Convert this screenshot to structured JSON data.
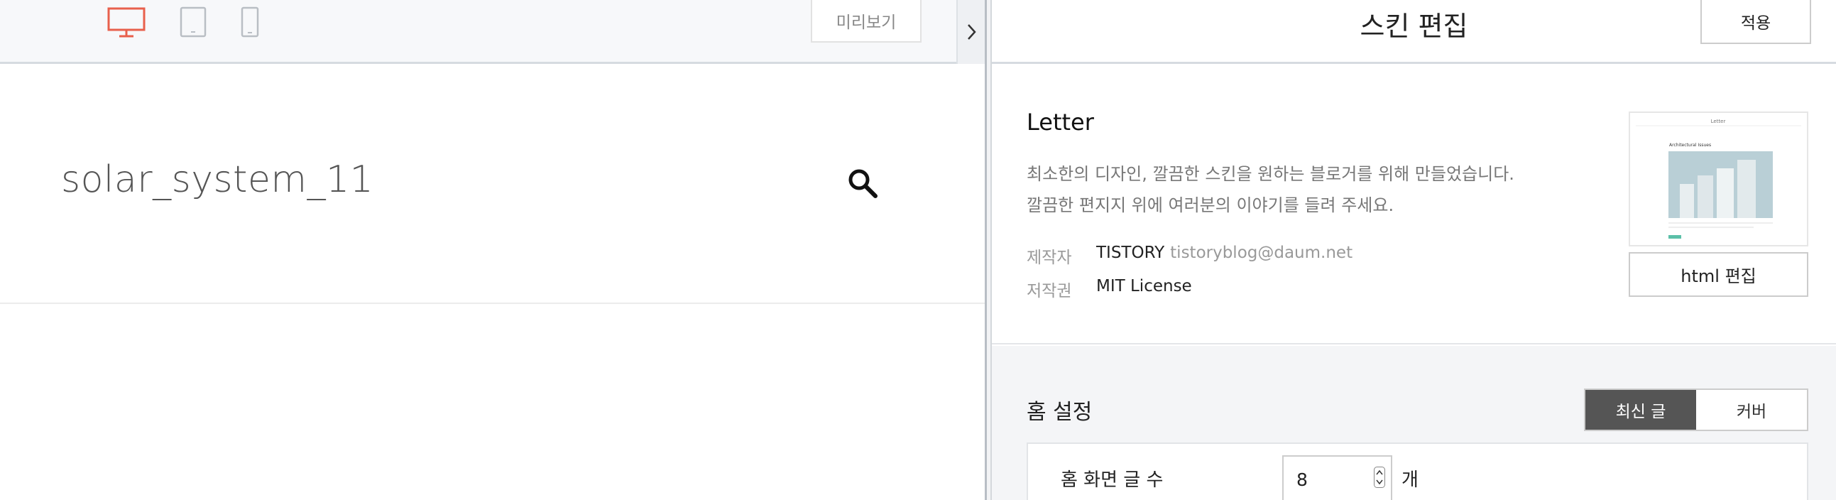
{
  "toolbar": {
    "devices": [
      "desktop-icon",
      "tablet-icon",
      "mobile-icon"
    ],
    "active_device": "desktop",
    "preview_label": "미리보기",
    "collapse_icon": "chevron-right-icon"
  },
  "preview": {
    "blog_title": "solar_system_11",
    "search_icon": "search-icon"
  },
  "panel": {
    "title": "스킨 편집",
    "apply_label": "적용",
    "skin": {
      "name": "Letter",
      "description_line1": "최소한의 디자인, 깔끔한 스킨을 원하는 블로거를 위해 만들었습니다.",
      "description_line2": "깔끔한 편지지 위에 여러분의 이야기를 들려 주세요.",
      "author_label": "제작자",
      "author_name": "TISTORY",
      "author_email": "tistoryblog@daum.net",
      "license_label": "저작권",
      "license_value": "MIT License",
      "thumbnail": {
        "header_text": "Letter",
        "post_title": "Architectural Issues"
      },
      "html_edit_label": "html 편집"
    },
    "home": {
      "title": "홈 설정",
      "options": [
        "최신 글",
        "커버"
      ],
      "selected_option": "최신 글",
      "post_count_label": "홈 화면 글 수",
      "post_count_value": "8",
      "post_count_unit": "개"
    }
  },
  "colors": {
    "active_device": "#e8604c",
    "segment_active": "#555555",
    "thumb_accent": "#5bc0a8"
  }
}
